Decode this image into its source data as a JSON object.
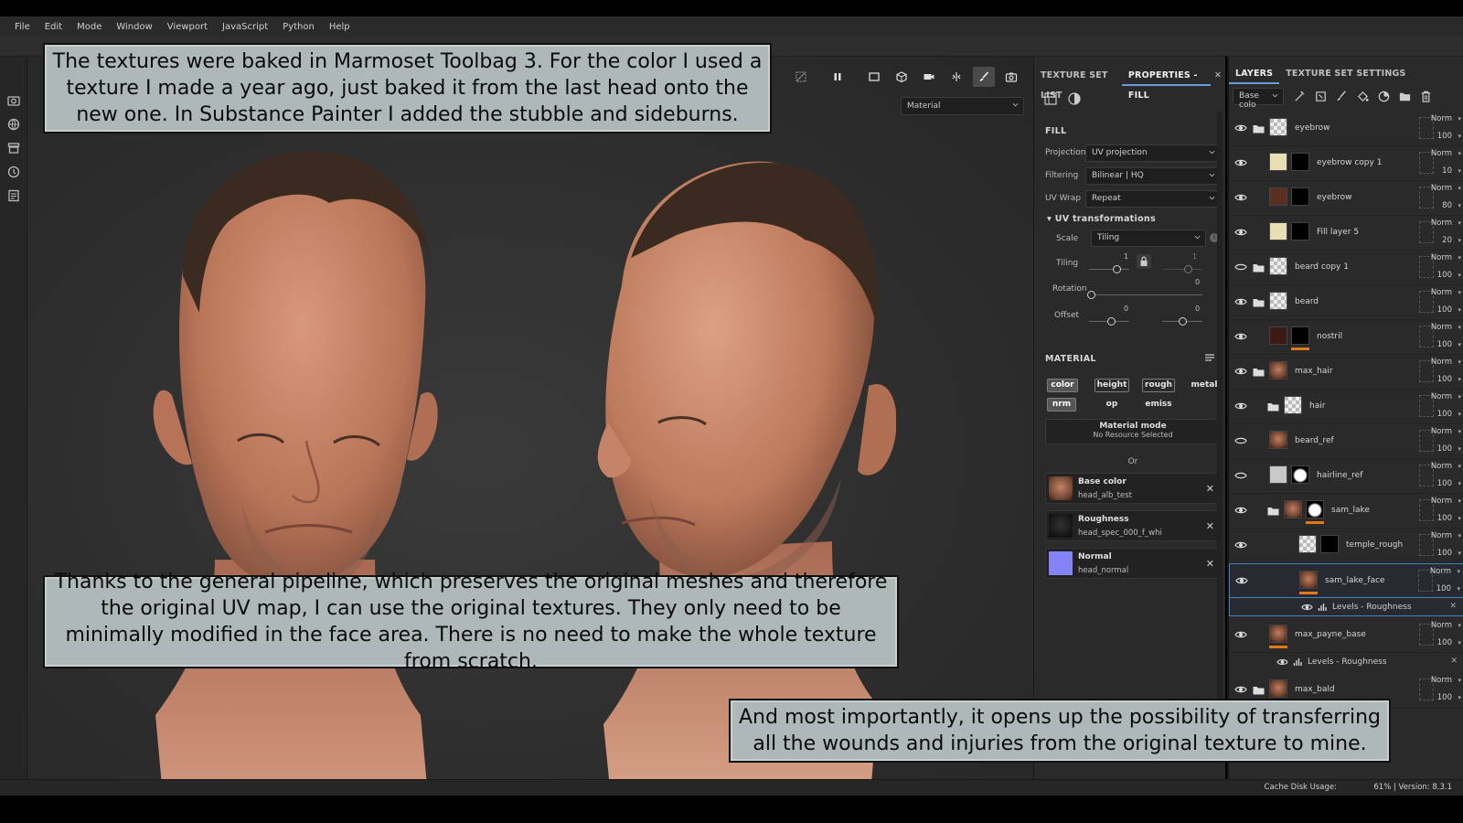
{
  "menu": [
    "File",
    "Edit",
    "Mode",
    "Window",
    "Viewport",
    "JavaScript",
    "Python",
    "Help"
  ],
  "viewport": {
    "material_select": "Material"
  },
  "captions": {
    "top": "The textures were baked in Marmoset Toolbag 3. For the color I used a texture I made a year ago, just baked it from the last head onto the new one. In Substance Painter I added the stubble and sideburns.",
    "middle": "Thanks to the general pipeline, which preserves the original meshes and therefore the original UV map, I can use the original textures. They only need to be minimally modified in the face area. There is no need to make the whole texture from scratch.",
    "bottom": "And most importantly, it opens up the possibility of transferring all the wounds and injuries from the original texture to mine."
  },
  "properties": {
    "tabs": [
      "TEXTURE SET LIST",
      "PROPERTIES - FILL"
    ],
    "fill_header": "FILL",
    "projection_label": "Projection",
    "projection_value": "UV projection",
    "filtering_label": "Filtering",
    "filtering_value": "Bilinear | HQ",
    "uvwrap_label": "UV Wrap",
    "uvwrap_value": "Repeat",
    "uvtrans_header": "UV transformations",
    "scale_label": "Scale",
    "scale_value": "Tiling",
    "tiling_label": "Tiling",
    "tiling_a": "1",
    "tiling_b": "1",
    "rotation_label": "Rotation",
    "rotation_value": "0",
    "offset_label": "Offset",
    "offset_a": "0",
    "offset_b": "0",
    "material_header": "MATERIAL",
    "channels": [
      "color",
      "height",
      "rough",
      "metal",
      "nrm",
      "op",
      "emiss"
    ],
    "material_mode_title": "Material mode",
    "material_mode_sub": "No Resource Selected",
    "or_label": "Or",
    "cards": [
      {
        "title": "Base color",
        "file": "head_alb_test"
      },
      {
        "title": "Roughness",
        "file": "head_spec_000_f_whi"
      },
      {
        "title": "Normal",
        "file": "head_normal"
      }
    ]
  },
  "layers_panel": {
    "tabs": [
      "LAYERS",
      "TEXTURE SET SETTINGS"
    ],
    "channel_select": "Base colo",
    "blend": "Norm",
    "rows": [
      {
        "name": "eyebrow",
        "opacity": "100"
      },
      {
        "name": "eyebrow copy 1",
        "opacity": "10"
      },
      {
        "name": "eyebrow",
        "opacity": "80"
      },
      {
        "name": "Fill layer 5",
        "opacity": "20"
      },
      {
        "name": "beard copy 1",
        "opacity": "100"
      },
      {
        "name": "beard",
        "opacity": "100"
      },
      {
        "name": "nostril",
        "opacity": "100"
      },
      {
        "name": "max_hair",
        "opacity": "100"
      },
      {
        "name": "hair",
        "opacity": "100"
      },
      {
        "name": "beard_ref",
        "opacity": "100"
      },
      {
        "name": "hairline_ref",
        "opacity": "100"
      },
      {
        "name": "sam_lake",
        "opacity": "100"
      },
      {
        "name": "temple_rough",
        "opacity": "100"
      },
      {
        "name": "sam_lake_face",
        "opacity": "100"
      },
      {
        "name": "max_payne_base",
        "opacity": "100"
      },
      {
        "name": "max_bald",
        "opacity": "100"
      }
    ],
    "sub_levels": "Levels - Roughness"
  },
  "status": {
    "cache_label": "Cache Disk Usage:",
    "cache_value": "61% | Version: 8.3.1"
  },
  "colors": {
    "accent_blue": "#4b7fc0",
    "orange_marker": "#e07b1b",
    "caption_bg": "#aeb8b9",
    "skin": "#c8866a"
  }
}
